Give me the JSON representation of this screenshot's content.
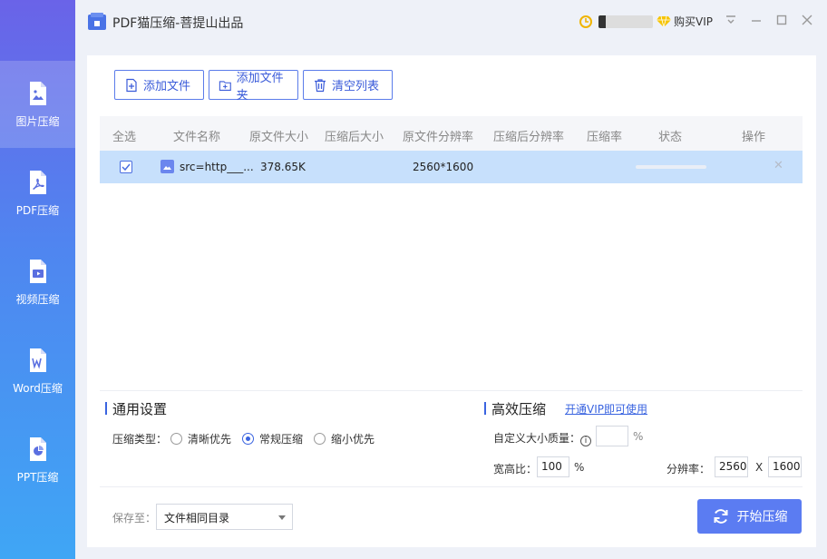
{
  "app": {
    "title": "PDF猫压缩-菩提山出品"
  },
  "user": {
    "coins": "1",
    "vip_label": "购买VIP"
  },
  "sidebar": {
    "items": [
      {
        "label": "图片压缩",
        "icon": "image-file-icon",
        "active": true
      },
      {
        "label": "PDF压缩",
        "icon": "pdf-file-icon",
        "active": false
      },
      {
        "label": "视频压缩",
        "icon": "video-file-icon",
        "active": false
      },
      {
        "label": "Word压缩",
        "icon": "word-file-icon",
        "active": false
      },
      {
        "label": "PPT压缩",
        "icon": "ppt-file-icon",
        "active": false
      }
    ]
  },
  "toolbar": {
    "add_file": "添加文件",
    "add_folder": "添加文件夹",
    "clear_list": "清空列表"
  },
  "table": {
    "headers": [
      "全选",
      "文件名称",
      "原文件大小",
      "压缩后大小",
      "原文件分辨率",
      "压缩后分辨率",
      "压缩率",
      "状态",
      "操作"
    ],
    "rows": [
      {
        "checked": true,
        "name": "src=http___...",
        "orig_size": "378.65K",
        "comp_size": "",
        "orig_res": "2560*1600",
        "comp_res": "",
        "ratio": "",
        "progress": 0
      }
    ]
  },
  "general": {
    "title": "通用设置",
    "type_label": "压缩类型：",
    "options": [
      "清晰优先",
      "常规压缩",
      "缩小优先"
    ],
    "selected": "常规压缩"
  },
  "advanced": {
    "title": "高效压缩",
    "vip_link": "开通VIP即可使用",
    "quality_label": "自定义大小质量：",
    "quality_value": "",
    "percent": "%",
    "aspect_label": "宽高比：",
    "aspect_value": "100",
    "aspect_percent": "%",
    "res_label": "分辨率：",
    "res_width": "2560",
    "res_sep": "X",
    "res_height": "1600"
  },
  "output": {
    "save_label": "保存至：",
    "save_option": "文件相同目录",
    "start_label": "开始压缩"
  },
  "colors": {
    "accent": "#5b7cf2",
    "row_selected": "#c7e0fc"
  }
}
